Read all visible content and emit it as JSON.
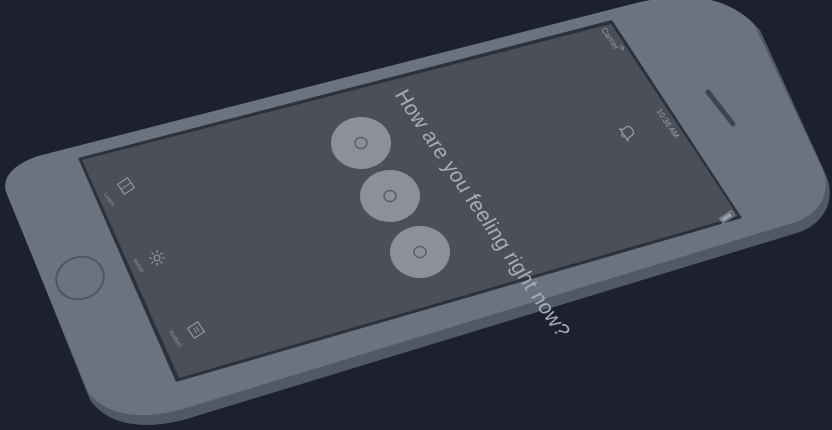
{
  "status_bar": {
    "carrier": "Carrier",
    "time": "10:38 AM"
  },
  "main": {
    "question": "How are you feeling right now?",
    "moods": [
      {
        "icon": "sad-face-icon"
      },
      {
        "icon": "neutral-face-icon"
      },
      {
        "icon": "happy-face-icon"
      }
    ]
  },
  "tab_bar": {
    "items": [
      {
        "label": "Learn",
        "icon": "book-icon"
      },
      {
        "label": "Relax",
        "icon": "sun-icon"
      },
      {
        "label": "Reflect",
        "icon": "journal-icon"
      }
    ]
  },
  "colors": {
    "background": "#1c212d",
    "device_body": "#6b7280",
    "screen": "#4a4f59",
    "button_fill": "#8c9099"
  }
}
